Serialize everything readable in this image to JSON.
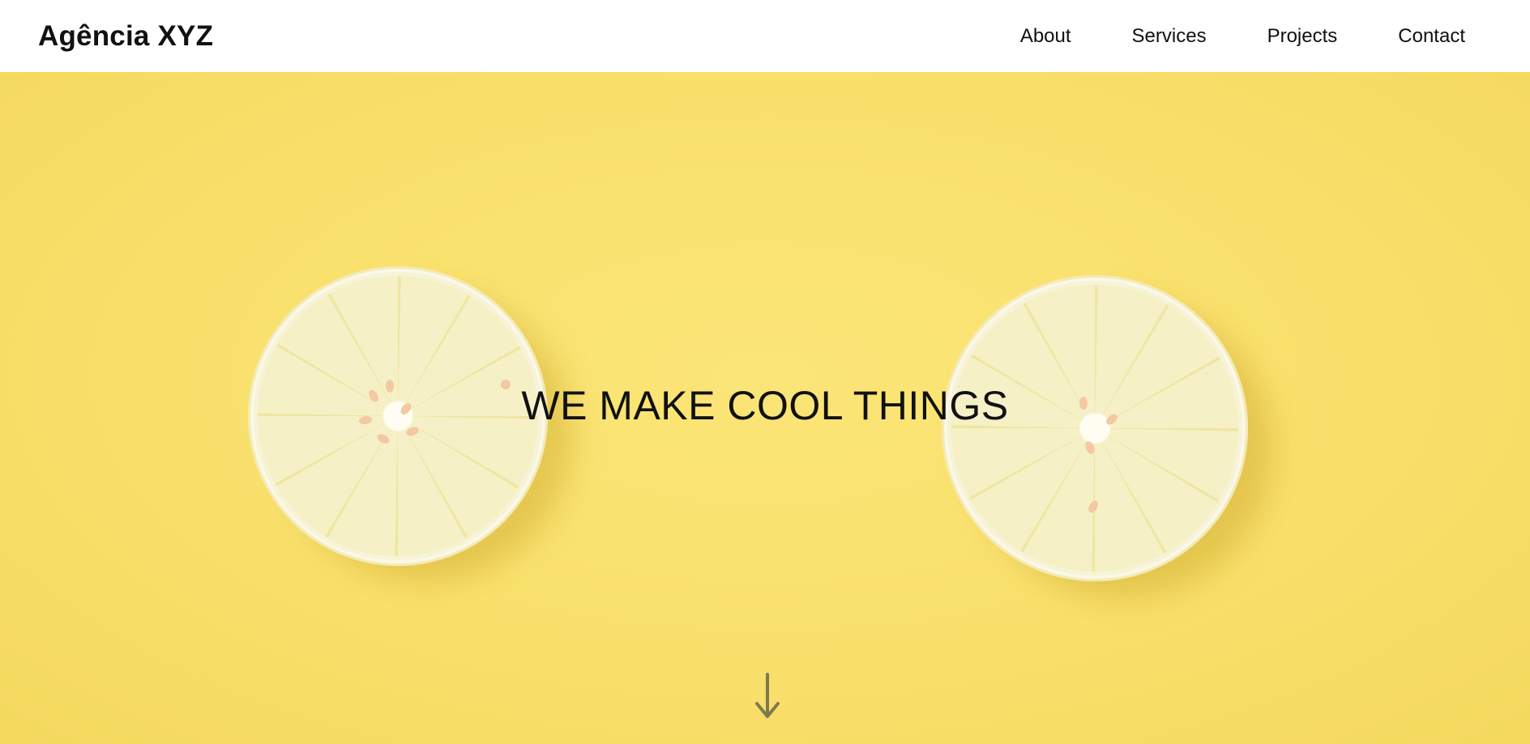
{
  "header": {
    "logo": "Agência XYZ",
    "nav": [
      {
        "label": "About"
      },
      {
        "label": "Services"
      },
      {
        "label": "Projects"
      },
      {
        "label": "Contact"
      }
    ]
  },
  "hero": {
    "title": "WE MAKE COOL THINGS",
    "background_color": "#f9e06b",
    "scroll_icon": "arrow-down-icon"
  }
}
